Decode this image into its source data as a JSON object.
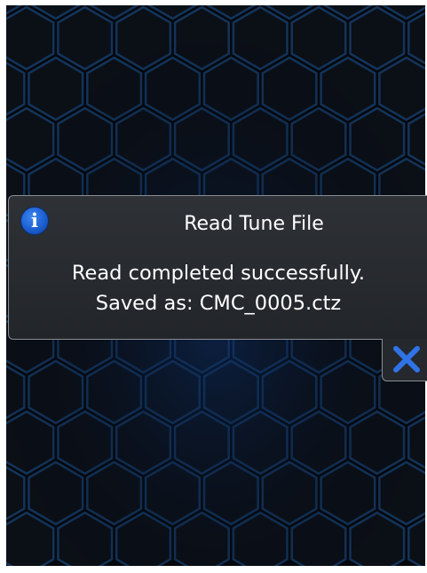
{
  "dialog": {
    "icon": "info-icon",
    "icon_glyph": "i",
    "title": "Read Tune File",
    "message_line1": "Read completed successfully.",
    "message_line2": "Saved as: CMC_0005.ctz",
    "close_icon": "close-icon"
  },
  "colors": {
    "background": "#05080d",
    "hex_outline": "#12355c",
    "dialog_bg": "#2a2d32",
    "dialog_border": "#8a8d92",
    "info_blue": "#1c5fd0",
    "close_x": "#2f73e6",
    "text": "#ffffff"
  }
}
